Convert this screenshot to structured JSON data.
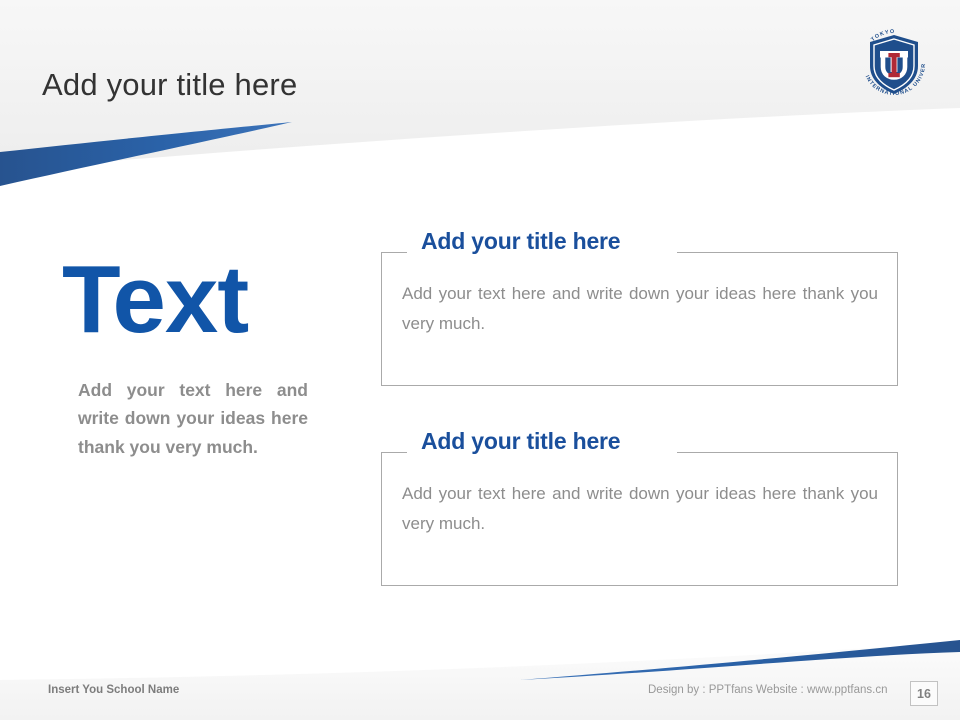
{
  "slide": {
    "title": "Add your title here",
    "page_number": "16",
    "accent_blue": "#1a4f9c",
    "swoosh_blue": "#2a5ea1",
    "body_gray": "#8d8d8d"
  },
  "logo": {
    "name": "tokyo-international-university-logo",
    "monogram": "TIU",
    "ring_text_top": "TOKYO",
    "ring_text_bottom": "INTERNATIONAL UNIVERSITY",
    "shield_color": "#1f4e8c",
    "accent_color": "#b02a37"
  },
  "left_column": {
    "headline": "Text",
    "body": "Add your text here and write down your ideas here thank you very much."
  },
  "boxes": [
    {
      "heading": "Add your title here",
      "body": "Add your text here and write down your ideas here thank you very much."
    },
    {
      "heading": "Add your title here",
      "body": "Add your text here and write down your ideas here thank you very much."
    }
  ],
  "footer": {
    "school_name": "Insert You School Name",
    "credit": "Design by : PPTfans  Website : www.pptfans.cn"
  }
}
